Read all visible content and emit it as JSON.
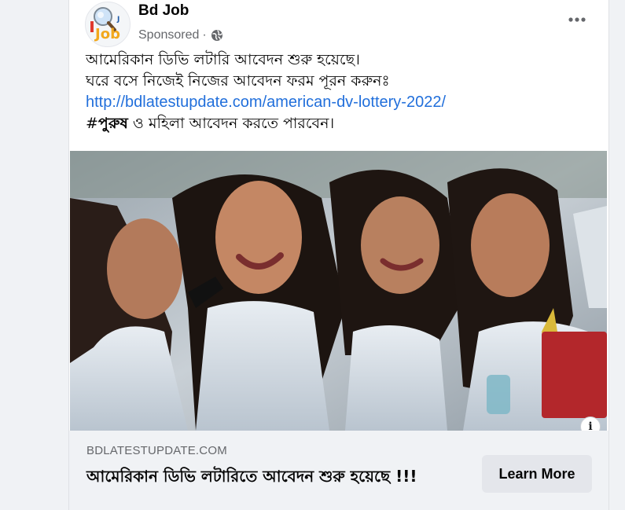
{
  "post": {
    "page_name": "Bd Job",
    "sponsored_label": "Sponsored",
    "separator": "·",
    "logo_text": "Job",
    "privacy_icon": "globe-icon",
    "more_icon": "more-options-icon",
    "text_lines": {
      "line1": "আমেরিকান ডিভি লটারি আবেদন শুরু হয়েছে।",
      "line2": "ঘরে বসে নিজেই নিজের আবেদন ফরম পূরন করুনঃ",
      "link": "http://bdlatestupdate.com/american-dv-lottery-2022/",
      "line4_prefix": "#",
      "line4_bold": "পুরুষ",
      "line4_rest": " ও মহিলা আবেদন করতে পারবেন।"
    }
  },
  "link_preview": {
    "domain": "BDLATESTUPDATE.COM",
    "title": "আমেরিকান ডিভি লটারিতে আবেদন শুরু হয়েছে !!!",
    "cta_label": "Learn More",
    "info_label": "i"
  },
  "colors": {
    "link": "#216fdb",
    "secondary_text": "#65676b",
    "button_bg": "#e4e6eb",
    "card_bg": "#ffffff",
    "page_bg": "#f0f2f5"
  }
}
